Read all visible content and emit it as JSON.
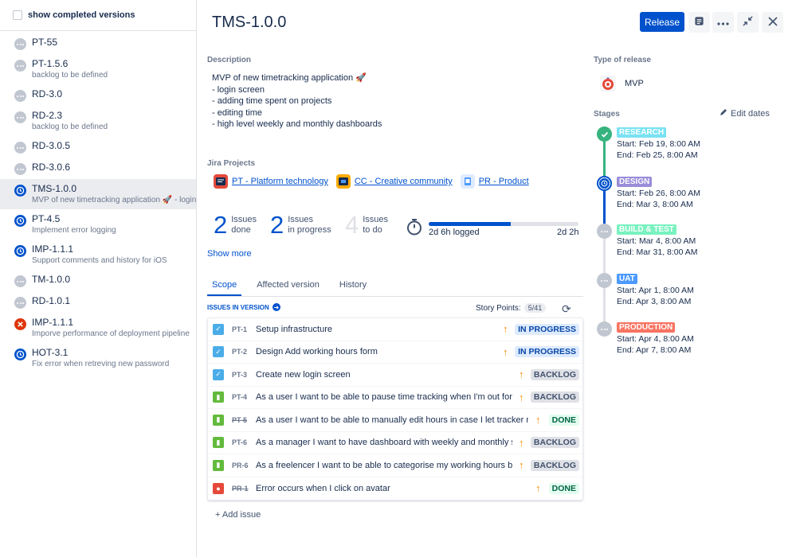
{
  "sidebar": {
    "show_completed_label": "show completed versions",
    "versions": [
      {
        "name": "PT-55",
        "desc": "",
        "icon": "grey"
      },
      {
        "name": "PT-1.5.6",
        "desc": "backlog to be defined",
        "icon": "grey"
      },
      {
        "name": "RD-3.0",
        "desc": "",
        "icon": "grey"
      },
      {
        "name": "RD-2.3",
        "desc": "backlog to be defined",
        "icon": "grey"
      },
      {
        "name": "RD-3.0.5",
        "desc": "",
        "icon": "grey"
      },
      {
        "name": "RD-3.0.6",
        "desc": "",
        "icon": "grey"
      },
      {
        "name": "TMS-1.0.0",
        "desc": "MVP of new timetracking application 🚀 - login s...",
        "icon": "blue"
      },
      {
        "name": "PT-4.5",
        "desc": "Implement error logging",
        "icon": "blue"
      },
      {
        "name": "IMP-1.1.1",
        "desc": "Support comments and history for iOS",
        "icon": "blue"
      },
      {
        "name": "TM-1.0.0",
        "desc": "",
        "icon": "grey"
      },
      {
        "name": "RD-1.0.1",
        "desc": "",
        "icon": "grey"
      },
      {
        "name": "IMP-1.1.1",
        "desc": "Imporve performance of deployment pipeline",
        "icon": "red"
      },
      {
        "name": "HOT-3.1",
        "desc": "Fix error when retreving new password",
        "icon": "blue"
      }
    ]
  },
  "header": {
    "title": "TMS-1.0.0",
    "release_label": "Release"
  },
  "description": {
    "label": "Description",
    "lines": [
      "MVP of new timetracking application 🚀",
      "- login screen",
      "- adding time spent on projects",
      "- editing time",
      "- high level weekly and monthly dashboards"
    ]
  },
  "jira_projects": {
    "label": "Jira Projects",
    "items": [
      {
        "name": "PT - Platform technology",
        "color": "#e5493a"
      },
      {
        "name": "CC - Creative community",
        "color": "#ffab00"
      },
      {
        "name": "PR - Product",
        "color": "#4c9aff"
      }
    ]
  },
  "stats": {
    "done": {
      "count": "2",
      "line1": "Issues",
      "line2": "done"
    },
    "in_progress": {
      "count": "2",
      "line1": "Issues",
      "line2": "in progress"
    },
    "to_do": {
      "count": "4",
      "line1": "Issues",
      "line2": "to do"
    },
    "logged": "2d 6h logged",
    "remaining": "2d 2h",
    "progress_fraction": 0.55
  },
  "show_more": "Show more",
  "tabs": [
    "Scope",
    "Affected version",
    "History"
  ],
  "issues_in_version_label": "ISSUES IN VERSION",
  "story_points": {
    "label": "Story Points:",
    "value": "5/41"
  },
  "issues": [
    {
      "type": "task",
      "key": "PT-1",
      "summary": "Setup infrastructure",
      "status": "IN PROGRESS",
      "status_kind": "progress",
      "strike": false
    },
    {
      "type": "task",
      "key": "PT-2",
      "summary": "Design Add working hours form",
      "status": "IN PROGRESS",
      "status_kind": "progress",
      "strike": false
    },
    {
      "type": "task",
      "key": "PT-3",
      "summary": "Create new login screen",
      "status": "BACKLOG",
      "status_kind": "backlog",
      "strike": false
    },
    {
      "type": "story",
      "key": "PT-4",
      "summary": "As a user I want to be able to pause time tracking when I'm out for a",
      "status": "BACKLOG",
      "status_kind": "backlog",
      "strike": false
    },
    {
      "type": "story",
      "key": "PT-5",
      "summary": "As a user I want to be able to manually edit hours in case I let tracker run",
      "status": "DONE",
      "status_kind": "done",
      "strike": true
    },
    {
      "type": "story",
      "key": "PT-6",
      "summary": "As a manager I want to have dashboard with weekly and monthly st",
      "status": "BACKLOG",
      "status_kind": "backlog",
      "strike": false
    },
    {
      "type": "story",
      "key": "PR-6",
      "summary": "As a freelencer I want to be able to categorise my working hours by",
      "status": "BACKLOG",
      "status_kind": "backlog",
      "strike": false
    },
    {
      "type": "bug",
      "key": "PR-1",
      "summary": "Error occurs when I click on avatar",
      "status": "DONE",
      "status_kind": "done",
      "strike": true
    }
  ],
  "add_issue": "+ Add issue",
  "release_type": {
    "label": "Type of release",
    "value": "MVP"
  },
  "stages": {
    "label": "Stages",
    "edit_dates": "Edit dates",
    "items": [
      {
        "name": "RESEARCH",
        "color": "#79e2f2",
        "start": "Start: Feb 19, 8:00 AM",
        "end": "End: Feb 25, 8:00 AM",
        "state": "done"
      },
      {
        "name": "DESIGN",
        "color": "#998dd9",
        "start": "Start: Feb 26, 8:00 AM",
        "end": "End: Mar 3, 8:00 AM",
        "state": "current"
      },
      {
        "name": "BUILD & TEST",
        "color": "#79f2c0",
        "start": "Start: Mar 4, 8:00 AM",
        "end": "End: Mar 31, 8:00 AM",
        "state": "future"
      },
      {
        "name": "UAT",
        "color": "#4c9aff",
        "start": "Start: Apr 1, 8:00 AM",
        "end": "End: Apr 3, 8:00 AM",
        "state": "future"
      },
      {
        "name": "PRODUCTION",
        "color": "#f87462",
        "start": "Start: Apr 4, 8:00 AM",
        "end": "End: Apr 7, 8:00 AM",
        "state": "future"
      }
    ]
  }
}
